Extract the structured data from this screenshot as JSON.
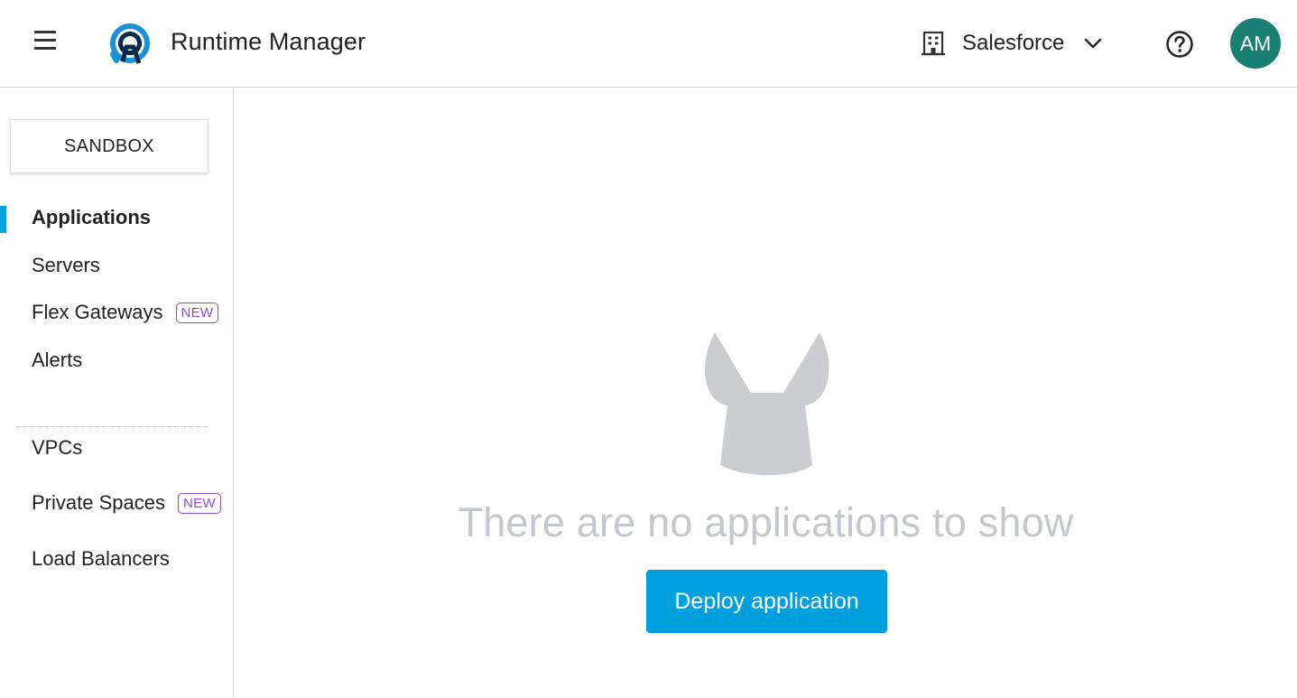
{
  "header": {
    "menu_icon": "hamburger-menu-icon",
    "logo_icon": "runtime-manager-logo-icon",
    "title": "Runtime Manager",
    "org_icon": "building-icon",
    "org_name": "Salesforce",
    "org_chevron_icon": "chevron-down-icon",
    "help_icon": "help-circle-icon",
    "avatar_initials": "AM",
    "avatar_color": "#1a7f73"
  },
  "sidebar": {
    "environment": "SANDBOX",
    "items": [
      {
        "label": "Applications",
        "active": true
      },
      {
        "label": "Servers"
      },
      {
        "label": "Flex Gateways",
        "badge": "NEW"
      },
      {
        "label": "Alerts"
      },
      {
        "label": "VPCs"
      },
      {
        "label": "Private Spaces",
        "badge": "NEW"
      },
      {
        "label": "Load Balancers"
      }
    ],
    "accent_color": "#00a2df",
    "badge_color": "#8a4dd9"
  },
  "main": {
    "empty_illustration_icon": "empty-state-bunny-icon",
    "empty_message": "There are no applications to show",
    "deploy_button_label": "Deploy application",
    "button_color": "#00a0df"
  }
}
